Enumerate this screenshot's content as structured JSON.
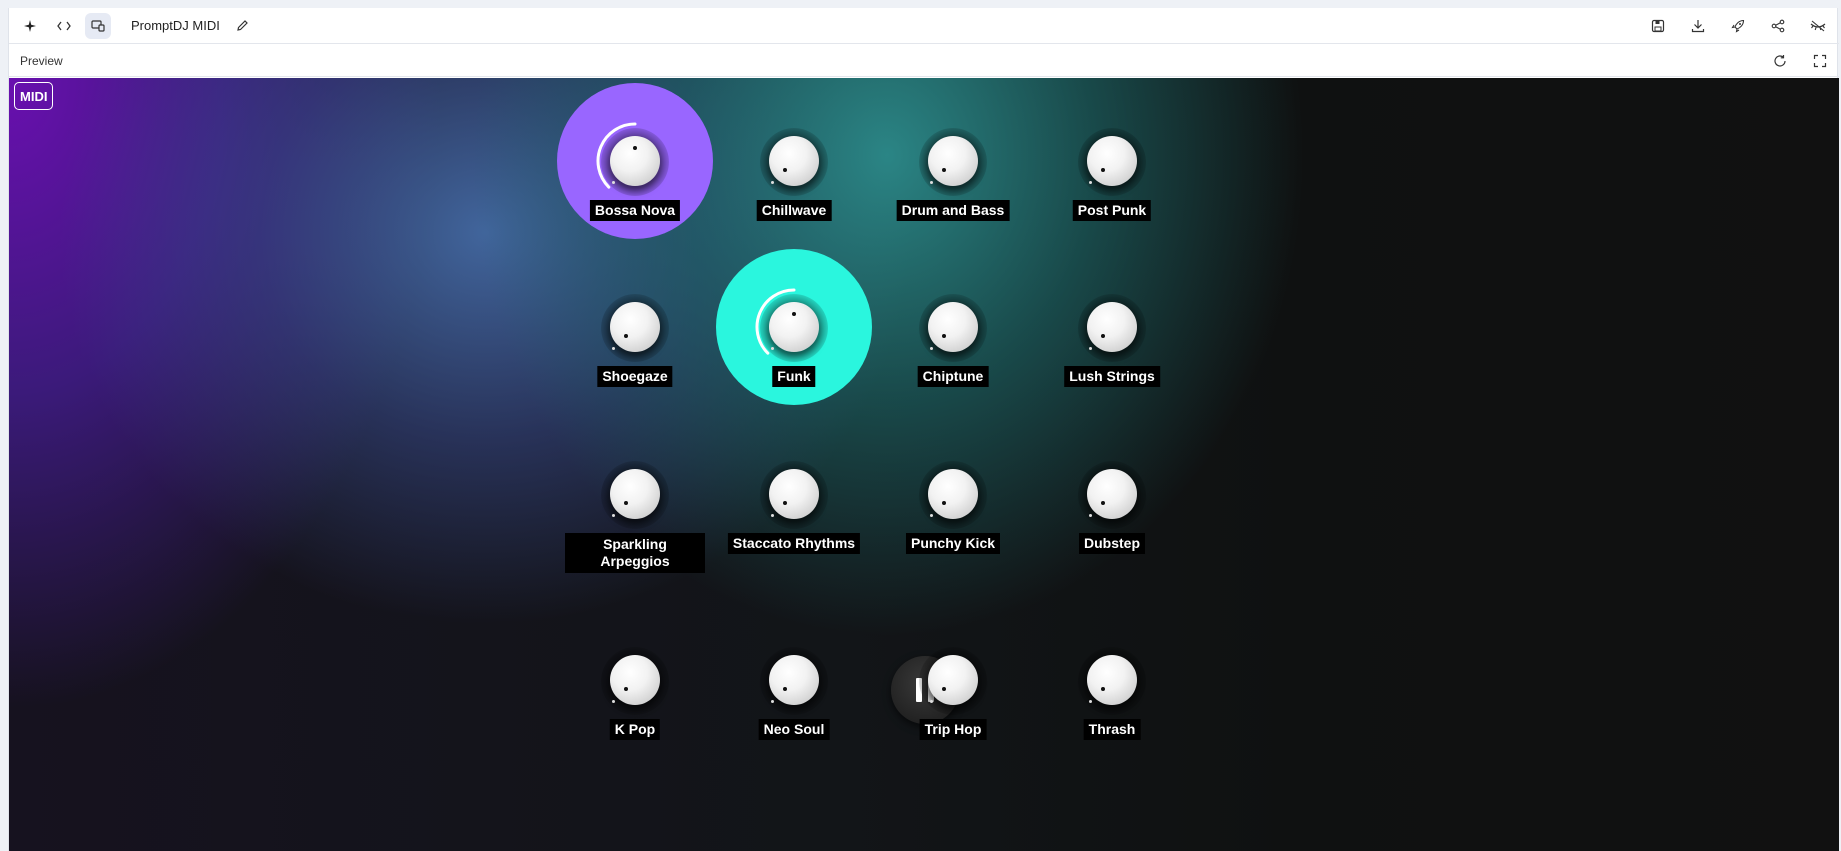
{
  "app": {
    "title": "PromptDJ MIDI",
    "preview_label": "Preview"
  },
  "midi_label": "MIDI",
  "prompts": [
    {
      "label": "Bossa Nova",
      "active": true,
      "color": "#9966ff",
      "value": 0.5
    },
    {
      "label": "Chillwave",
      "active": false,
      "color": "#5a8f8f",
      "value": 0.0
    },
    {
      "label": "Drum and Bass",
      "active": false,
      "color": "#5a8f8f",
      "value": 0.0
    },
    {
      "label": "Post Punk",
      "active": false,
      "color": "#5a8f8f",
      "value": 0.0
    },
    {
      "label": "Shoegaze",
      "active": false,
      "color": "#5a8f8f",
      "value": 0.0
    },
    {
      "label": "Funk",
      "active": true,
      "color": "#2af6de",
      "value": 0.5
    },
    {
      "label": "Chiptune",
      "active": false,
      "color": "#5a8f8f",
      "value": 0.0
    },
    {
      "label": "Lush Strings",
      "active": false,
      "color": "#5a8f8f",
      "value": 0.0
    },
    {
      "label": "Sparkling Arpeggios",
      "active": false,
      "color": "#5a8f8f",
      "value": 0.0
    },
    {
      "label": "Staccato Rhythms",
      "active": false,
      "color": "#5a8f8f",
      "value": 0.0
    },
    {
      "label": "Punchy Kick",
      "active": false,
      "color": "#5a8f8f",
      "value": 0.0
    },
    {
      "label": "Dubstep",
      "active": false,
      "color": "#5a8f8f",
      "value": 0.0
    },
    {
      "label": "K Pop",
      "active": false,
      "color": "#5a8f8f",
      "value": 0.0
    },
    {
      "label": "Neo Soul",
      "active": false,
      "color": "#5a8f8f",
      "value": 0.0
    },
    {
      "label": "Trip Hop",
      "active": false,
      "color": "#5a8f8f",
      "value": 0.0
    },
    {
      "label": "Thrash",
      "active": false,
      "color": "#5a8f8f",
      "value": 0.0
    }
  ],
  "toolbar_icons": [
    "sparkle-icon",
    "code-icon",
    "device-preview-icon",
    "pencil-icon",
    "save-icon",
    "download-icon",
    "rocket-icon",
    "share-icon",
    "hide-icon",
    "refresh-icon",
    "fullscreen-icon"
  ]
}
